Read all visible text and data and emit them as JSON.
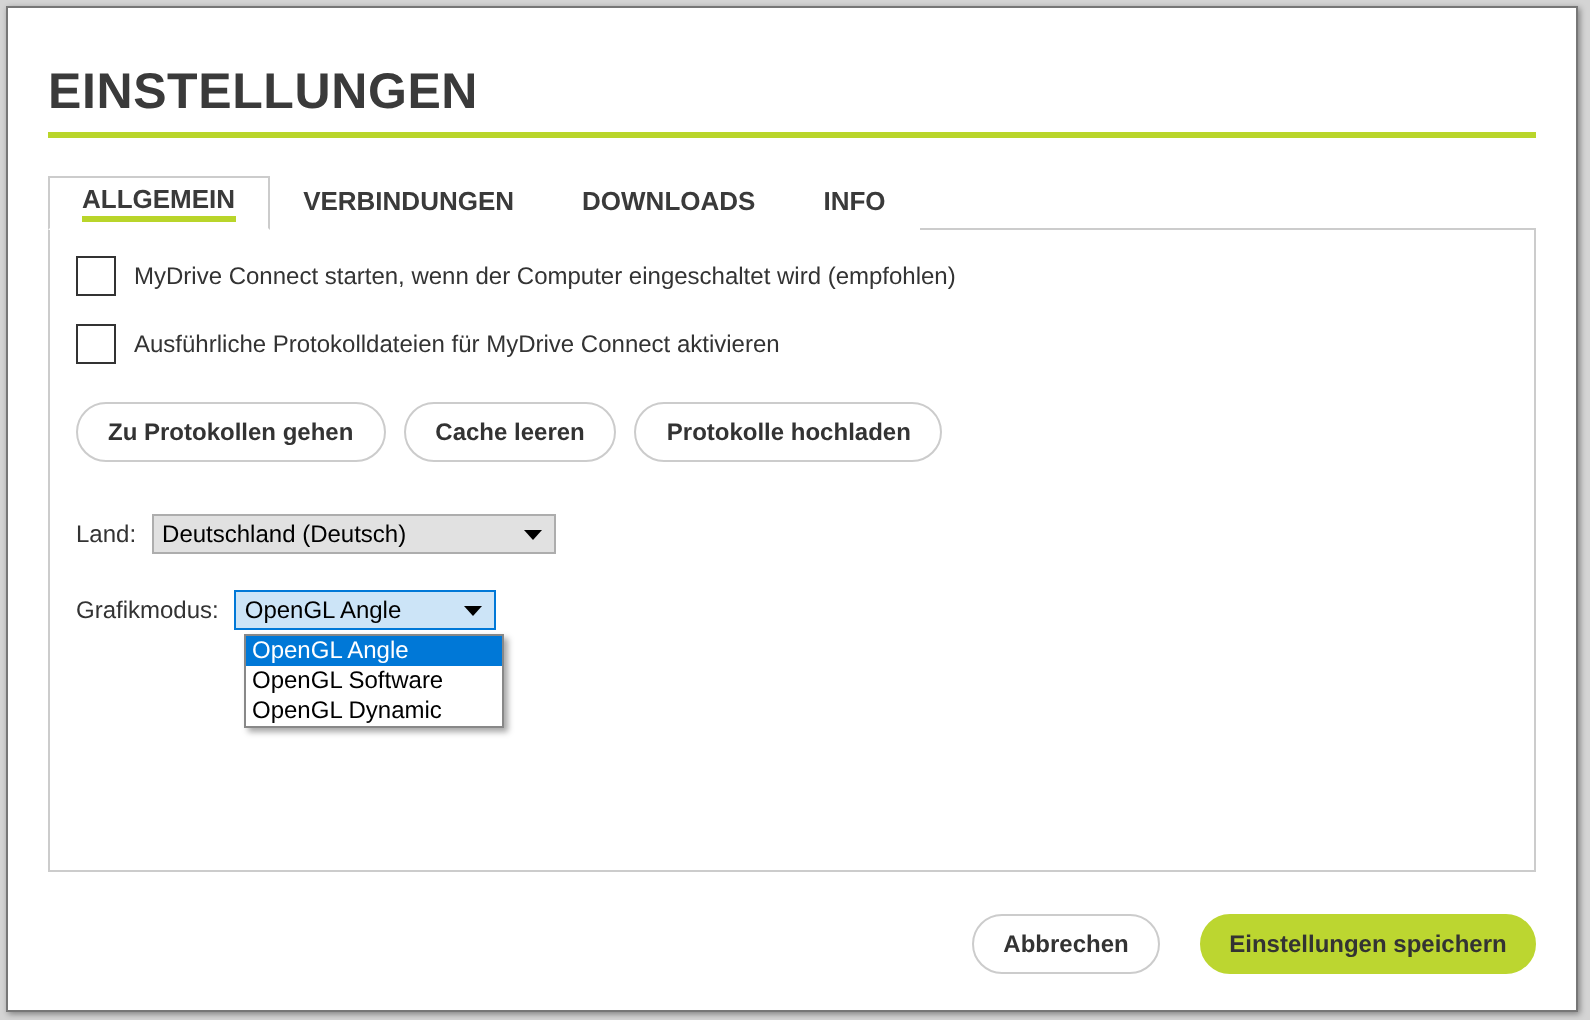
{
  "title": "EINSTELLUNGEN",
  "tabs": [
    {
      "label": "ALLGEMEIN",
      "selected": true
    },
    {
      "label": "VERBINDUNGEN",
      "selected": false
    },
    {
      "label": "DOWNLOADS",
      "selected": false
    },
    {
      "label": "INFO",
      "selected": false
    }
  ],
  "checkboxes": [
    {
      "label": "MyDrive Connect starten, wenn der Computer eingeschaltet wird (empfohlen)",
      "checked": false
    },
    {
      "label": "Ausführliche Protokolldateien für MyDrive Connect aktivieren",
      "checked": false
    }
  ],
  "actions": [
    "Zu Protokollen gehen",
    "Cache leeren",
    "Protokolle hochladen"
  ],
  "country": {
    "label": "Land:",
    "value": "Deutschland (Deutsch)"
  },
  "graphics": {
    "label": "Grafikmodus:",
    "value": "OpenGL Angle",
    "expanded": true,
    "options": [
      {
        "label": "OpenGL Angle",
        "selected": true
      },
      {
        "label": "OpenGL Software",
        "selected": false
      },
      {
        "label": "OpenGL Dynamic",
        "selected": false
      }
    ]
  },
  "footer": {
    "cancel": "Abbrechen",
    "save": "Einstellungen speichern"
  }
}
